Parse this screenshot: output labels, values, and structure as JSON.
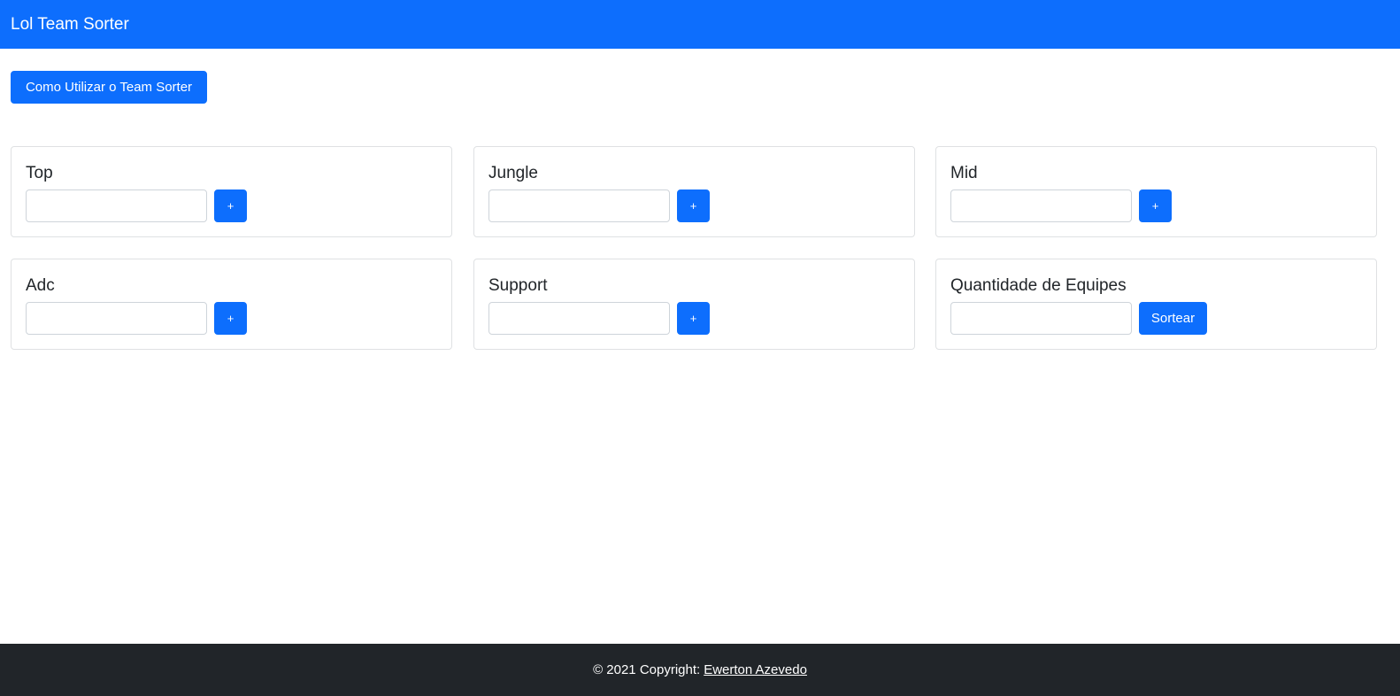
{
  "navbar": {
    "brand": "Lol Team Sorter"
  },
  "help_button": {
    "label": "Como Utilizar o Team Sorter"
  },
  "cards": {
    "top": {
      "title": "Top",
      "input_value": "",
      "button_label": "+"
    },
    "jungle": {
      "title": "Jungle",
      "input_value": "",
      "button_label": "+"
    },
    "mid": {
      "title": "Mid",
      "input_value": "",
      "button_label": "+"
    },
    "adc": {
      "title": "Adc",
      "input_value": "",
      "button_label": "+"
    },
    "support": {
      "title": "Support",
      "input_value": "",
      "button_label": "+"
    },
    "teams": {
      "title": "Quantidade de Equipes",
      "input_value": "",
      "button_label": "Sortear"
    }
  },
  "footer": {
    "prefix": "© 2021 Copyright:",
    "author_link": "Ewerton Azevedo"
  },
  "colors": {
    "primary": "#0d6efd",
    "footer_bg": "#212529",
    "card_border": "#dfe1e3"
  }
}
